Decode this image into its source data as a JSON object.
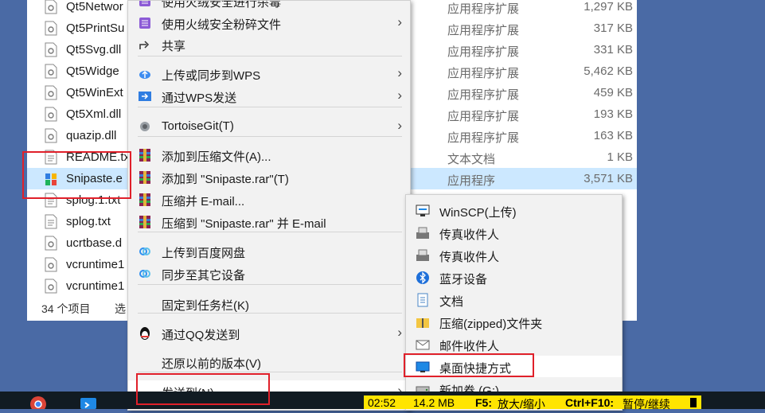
{
  "explorer": {
    "files": [
      {
        "name": "Qt5Networ",
        "type": "应用程序扩展",
        "size": "1,297 KB",
        "icon": "dll-file-icon"
      },
      {
        "name": "Qt5PrintSu",
        "type": "应用程序扩展",
        "size": "317 KB",
        "icon": "dll-file-icon"
      },
      {
        "name": "Qt5Svg.dll",
        "type": "应用程序扩展",
        "size": "331 KB",
        "icon": "dll-file-icon"
      },
      {
        "name": "Qt5Widge",
        "type": "应用程序扩展",
        "size": "5,462 KB",
        "icon": "dll-file-icon"
      },
      {
        "name": "Qt5WinExt",
        "type": "应用程序扩展",
        "size": "459 KB",
        "icon": "dll-file-icon"
      },
      {
        "name": "Qt5Xml.dll",
        "type": "应用程序扩展",
        "size": "193 KB",
        "icon": "dll-file-icon"
      },
      {
        "name": "quazip.dll",
        "type": "应用程序扩展",
        "size": "163 KB",
        "icon": "dll-file-icon"
      },
      {
        "name": "README.tx",
        "type": "文本文档",
        "size": "1 KB",
        "icon": "text-file-icon"
      },
      {
        "name": "Snipaste.e",
        "type": "应用程序",
        "size": "3,571 KB",
        "icon": "snipaste-app-icon"
      },
      {
        "name": "splog.1.txt",
        "type": "",
        "size": "",
        "icon": "text-file-icon"
      },
      {
        "name": "splog.txt",
        "type": "",
        "size": "",
        "icon": "text-file-icon"
      },
      {
        "name": "ucrtbase.d",
        "type": "",
        "size": "",
        "icon": "dll-file-icon"
      },
      {
        "name": "vcruntime1",
        "type": "",
        "size": "",
        "icon": "dll-file-icon"
      },
      {
        "name": "vcruntime1",
        "type": "",
        "size": "",
        "icon": "dll-file-icon"
      }
    ],
    "status_count": "34 个项目",
    "status_selected": "选"
  },
  "context_menu": {
    "items": [
      {
        "label": "使用火绒安全进行杀毒",
        "icon": "huorong-shield-icon",
        "submenu": false
      },
      {
        "label": "使用火绒安全粉碎文件",
        "icon": "huorong-shredder-icon",
        "submenu": true
      },
      {
        "label": "共享",
        "icon": "share-icon",
        "submenu": false
      },
      {
        "label": "上传或同步到WPS",
        "icon": "wps-cloud-upload-icon",
        "submenu": true
      },
      {
        "label": "通过WPS发送",
        "icon": "wps-send-icon",
        "submenu": true
      },
      {
        "label": "TortoiseGit(T)",
        "icon": "tortoisegit-icon",
        "submenu": true
      },
      {
        "label": "添加到压缩文件(A)...",
        "icon": "winrar-icon",
        "submenu": false
      },
      {
        "label": "添加到 \"Snipaste.rar\"(T)",
        "icon": "winrar-icon",
        "submenu": false
      },
      {
        "label": "压缩并 E-mail...",
        "icon": "winrar-icon",
        "submenu": false
      },
      {
        "label": "压缩到 \"Snipaste.rar\" 并 E-mail",
        "icon": "winrar-icon",
        "submenu": false
      },
      {
        "label": "上传到百度网盘",
        "icon": "baidu-netdisk-icon",
        "submenu": false
      },
      {
        "label": "同步至其它设备",
        "icon": "baidu-netdisk-icon",
        "submenu": false
      },
      {
        "label": "固定到任务栏(K)",
        "icon": "",
        "submenu": false
      },
      {
        "label": "通过QQ发送到",
        "icon": "qq-penguin-icon",
        "submenu": true
      },
      {
        "label": "还原以前的版本(V)",
        "icon": "",
        "submenu": false
      },
      {
        "label": "发送到(N)",
        "icon": "",
        "submenu": true
      }
    ],
    "submenu_arrow": "›"
  },
  "send_to_menu": {
    "items": [
      {
        "label": "WinSCP(上传)",
        "icon": "winscp-icon"
      },
      {
        "label": "传真收件人",
        "icon": "fax-icon"
      },
      {
        "label": "传真收件人",
        "icon": "fax-icon"
      },
      {
        "label": "蓝牙设备",
        "icon": "bluetooth-icon"
      },
      {
        "label": "文档",
        "icon": "documents-icon"
      },
      {
        "label": "压缩(zipped)文件夹",
        "icon": "zip-folder-icon"
      },
      {
        "label": "邮件收件人",
        "icon": "mail-icon"
      },
      {
        "label": "桌面快捷方式",
        "icon": "desktop-icon"
      },
      {
        "label": "新加卷 (G:)",
        "icon": "drive-icon"
      }
    ]
  },
  "recorder_bar": {
    "time": "02:52",
    "size": "14.2 MB",
    "f5_key": "F5:",
    "f5_action": "放大/缩小",
    "f10_key": "Ctrl+F10:",
    "f10_action": "暂停/继续"
  },
  "taskbar": {
    "icons": [
      "chrome-icon",
      "vscode-icon"
    ]
  },
  "colors": {
    "selection": "#cce8ff",
    "highlight_box": "#e0202a",
    "recorder_bar": "#ffe500",
    "taskbar": "#111b22",
    "desktop": "#4a6aa5"
  }
}
